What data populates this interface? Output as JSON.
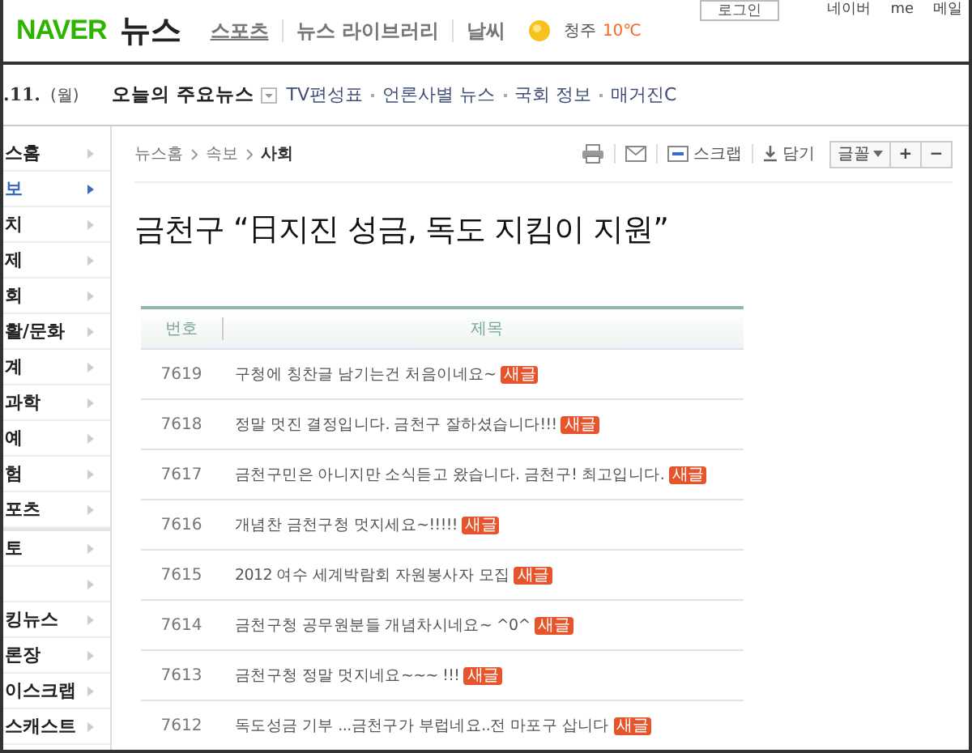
{
  "header": {
    "logo": "NAVER",
    "section": "뉴스",
    "links": [
      "스포츠",
      "뉴스 라이브러리",
      "날씨"
    ],
    "weather": {
      "city": "청주",
      "temp": "10℃"
    },
    "login": "로그인",
    "top_links": [
      "네이버",
      "me",
      "메일"
    ]
  },
  "nav": {
    "date": ".11.",
    "weekday": "(월)",
    "main": "오늘의 주요뉴스",
    "links": [
      "TV편성표",
      "언론사별 뉴스",
      "국회 정보",
      "매거진C"
    ]
  },
  "sidebar": {
    "groups": [
      [
        {
          "label": "스홈",
          "selected": false
        },
        {
          "label": "보",
          "selected": true
        },
        {
          "label": "치",
          "selected": false
        },
        {
          "label": "제",
          "selected": false
        },
        {
          "label": "회",
          "selected": false
        },
        {
          "label": "활/문화",
          "selected": false
        },
        {
          "label": "계",
          "selected": false
        },
        {
          "label": "과학",
          "selected": false
        },
        {
          "label": "예",
          "selected": false
        },
        {
          "label": "험",
          "selected": false
        },
        {
          "label": "포츠",
          "selected": false
        }
      ],
      [
        {
          "label": "토",
          "selected": false
        },
        {
          "selected": false
        },
        {
          "label": "킹뉴스",
          "selected": false
        },
        {
          "label": "론장",
          "selected": false
        },
        {
          "label": "이스크랩",
          "selected": false
        },
        {
          "label": "스캐스트",
          "selected": false
        }
      ]
    ]
  },
  "breadcrumb": [
    "뉴스홈",
    "속보",
    "사회"
  ],
  "toolbar": {
    "scrap": "스크랩",
    "save": "담기",
    "font": "글꼴",
    "plus": "+",
    "minus": "−"
  },
  "article": {
    "title": "금천구 “日지진 성금, 독도 지킴이 지원”",
    "table": {
      "columns": [
        "번호",
        "제목"
      ],
      "rows": [
        {
          "no": "7619",
          "title": "구청에 칭찬글 남기는건 처음이네요~",
          "badge": "새글"
        },
        {
          "no": "7618",
          "title": "정말 멋진 결정입니다. 금천구 잘하셨습니다!!!",
          "badge": "새글"
        },
        {
          "no": "7617",
          "title": "금천구민은 아니지만 소식듣고 왔습니다. 금천구! 최고입니다.",
          "badge": "새글"
        },
        {
          "no": "7616",
          "title": "개념찬 금천구청 멋지세요~!!!!!",
          "badge": "새글"
        },
        {
          "no": "7615",
          "title": "2012 여수 세계박람회 자원봉사자 모집",
          "badge": "새글"
        },
        {
          "no": "7614",
          "title": "금천구청 공무원분들 개념차시네요~ ^0^",
          "badge": "새글"
        },
        {
          "no": "7613",
          "title": "금천구청 정말 멋지네요~~~ !!!",
          "badge": "새글"
        },
        {
          "no": "7612",
          "title": "독도성금 기부 ...금천구가 부럽네요..전 마포구 삽니다",
          "badge": "새글"
        }
      ]
    }
  }
}
